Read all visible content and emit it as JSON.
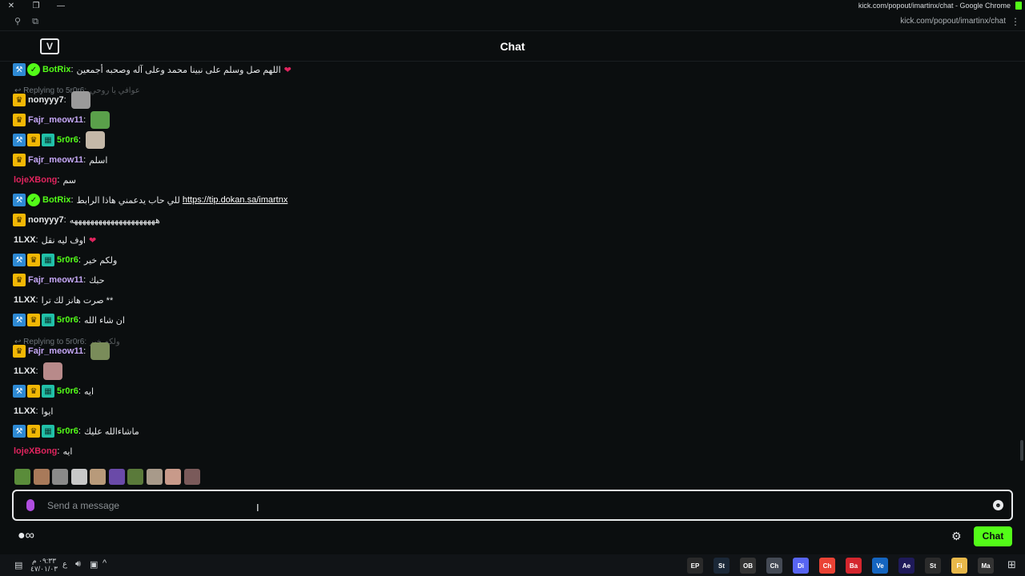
{
  "window": {
    "title": "kick.com/popout/imartinx/chat - Google Chrome",
    "url": "kick.com/popout/imartinx/chat"
  },
  "header": {
    "title": "Chat",
    "logo_text": "V"
  },
  "messages": [
    {
      "user": "BotRix",
      "color": "#53fc18",
      "badges": [
        "mod",
        "verified"
      ],
      "text": "اللهم صل وسلم على نبينا محمد وعلى آله وصحبه أجمعين",
      "heart": "❤"
    },
    {
      "reply": true,
      "reply_label": "Replying to 5r0r6:",
      "reply_text": "عوافي يا روحي"
    },
    {
      "user": "nonyyy7",
      "color": "#e6e8ea",
      "badges": [
        "vip"
      ],
      "emotes": 1
    },
    {
      "user": "Fajr_meow11",
      "color": "#c4a6f5",
      "badges": [
        "vip"
      ],
      "emotes": 1
    },
    {
      "user": "5r0r6",
      "color": "#53fc18",
      "badges": [
        "mod",
        "vip",
        "og"
      ],
      "emotes": 1
    },
    {
      "user": "Fajr_meow11",
      "color": "#c4a6f5",
      "badges": [
        "vip"
      ],
      "text": "اسلم"
    },
    {
      "user": "lojeXBong",
      "color": "#e0245e",
      "badges": [],
      "text": "سم"
    },
    {
      "user": "BotRix",
      "color": "#53fc18",
      "badges": [
        "mod",
        "verified"
      ],
      "text": "للي حاب يدعمني هاذا الرابط",
      "link": "https://tip.dokan.sa/imartnx"
    },
    {
      "user": "nonyyy7",
      "color": "#e6e8ea",
      "badges": [
        "vip"
      ],
      "text": "هههههههههههههههههههههه"
    },
    {
      "user": "1LXX",
      "color": "#e6e8ea",
      "badges": [],
      "text": "اوف ليه نقل",
      "heart": "❤"
    },
    {
      "user": "5r0r6",
      "color": "#53fc18",
      "badges": [
        "mod",
        "vip",
        "og"
      ],
      "text": "ولكم خير"
    },
    {
      "user": "Fajr_meow11",
      "color": "#c4a6f5",
      "badges": [
        "vip"
      ],
      "text": "حبك"
    },
    {
      "user": "1LXX",
      "color": "#e6e8ea",
      "badges": [],
      "text": "صرت هانز لك ترا **"
    },
    {
      "user": "5r0r6",
      "color": "#53fc18",
      "badges": [
        "mod",
        "vip",
        "og"
      ],
      "text": "ان شاء الله"
    },
    {
      "reply": true,
      "reply_label": "Replying to 5r0r6:",
      "reply_text": "ولكم خير"
    },
    {
      "user": "Fajr_meow11",
      "color": "#c4a6f5",
      "badges": [
        "vip"
      ],
      "emotes": 1
    },
    {
      "user": "1LXX",
      "color": "#e6e8ea",
      "badges": [],
      "emotes": 1
    },
    {
      "user": "5r0r6",
      "color": "#53fc18",
      "badges": [
        "mod",
        "vip",
        "og"
      ],
      "text": "ايه"
    },
    {
      "user": "1LXX",
      "color": "#e6e8ea",
      "badges": [],
      "text": "ايوا"
    },
    {
      "user": "5r0r6",
      "color": "#53fc18",
      "badges": [
        "mod",
        "vip",
        "og"
      ],
      "text": "ماشاءالله عليك"
    },
    {
      "user": "lojeXBong",
      "color": "#e0245e",
      "badges": [],
      "text": "ايه"
    }
  ],
  "emote_picker": {
    "count": 10
  },
  "input": {
    "placeholder": "Send a message"
  },
  "footer": {
    "chat_button": "Chat",
    "left_icons": "●∞"
  },
  "taskbar": {
    "time": "٠٩:٣٣ م",
    "date": "٤٧/٠١/٠٣",
    "lang": "ع",
    "apps": [
      "EPIC",
      "Steam",
      "OBS",
      "Chrome",
      "Discord",
      "Chrome",
      "Bandicam",
      "Vegas",
      "Ae",
      "Store",
      "Files",
      "Mail"
    ]
  }
}
